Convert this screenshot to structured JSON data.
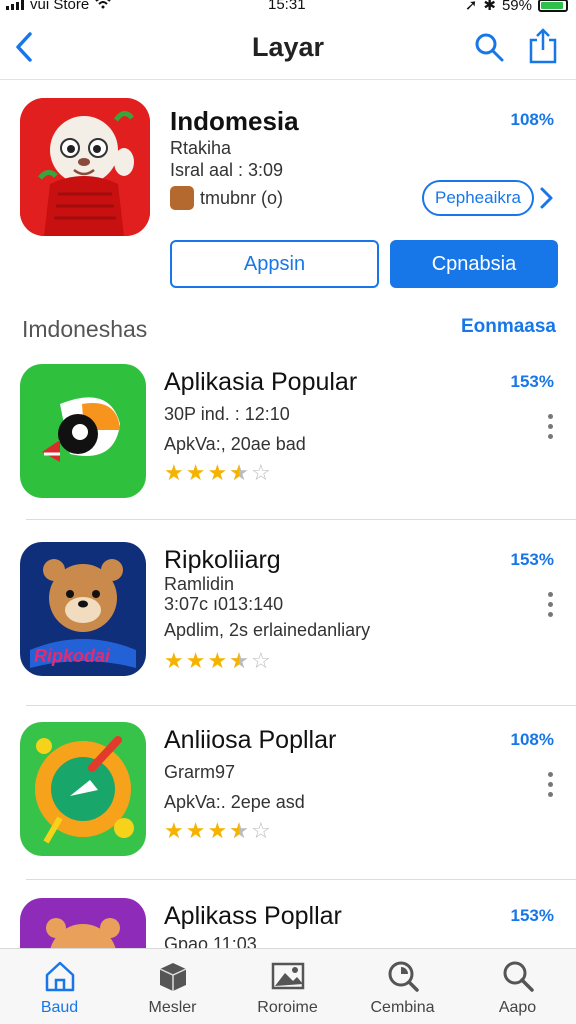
{
  "status_bar": {
    "carrier": "vui Store",
    "time": "15:31",
    "battery": "59%"
  },
  "nav": {
    "title": "Layar",
    "back_icon": "chevron-left-icon",
    "search_icon": "search-icon",
    "share_icon": "share-icon"
  },
  "featured": {
    "title": "Indomesia",
    "subtitle": "Rtakiha",
    "meta": "Isral aal : 3:09",
    "developer": "tmubnr (o)",
    "percent": "108%",
    "pill_label": "Pepheaikra",
    "button_outline": "Appsin",
    "button_solid": "Cpnabsia"
  },
  "section": {
    "title": "Imdoneshas",
    "link": "Eonmaasa"
  },
  "apps": [
    {
      "name": "Aplikasia Popular",
      "line1": "30P ind. : 12:10",
      "line2": "ApkVa:, 20ae bad",
      "percent": "153%",
      "rating": 3.5
    },
    {
      "name": "Ripkoliiarg",
      "subtitle": "Ramlidin",
      "line1": "3:07c ı013:140",
      "line2": "Apdlim, 2s erlainedanliary",
      "percent": "153%",
      "rating": 3.5,
      "icon_text": "Ripkodai"
    },
    {
      "name": "Anliiosa Popllar",
      "line1": "Grarm97",
      "line2": "ApkVa:. 2epe asd",
      "percent": "108%",
      "rating": 3.5
    },
    {
      "name": "Aplikass Popllar",
      "line1": "Gpao 11:03",
      "percent": "153%"
    }
  ],
  "tabs": [
    {
      "label": "Baud",
      "icon": "home-icon",
      "active": true
    },
    {
      "label": "Mesler",
      "icon": "box-icon"
    },
    {
      "label": "Roroime",
      "icon": "photo-icon"
    },
    {
      "label": "Cembina",
      "icon": "search-circle-icon"
    },
    {
      "label": "Aapo",
      "icon": "search-icon"
    }
  ],
  "colors": {
    "accent": "#1877e8",
    "star": "#f5b301",
    "divider": "#dcdcdc"
  }
}
